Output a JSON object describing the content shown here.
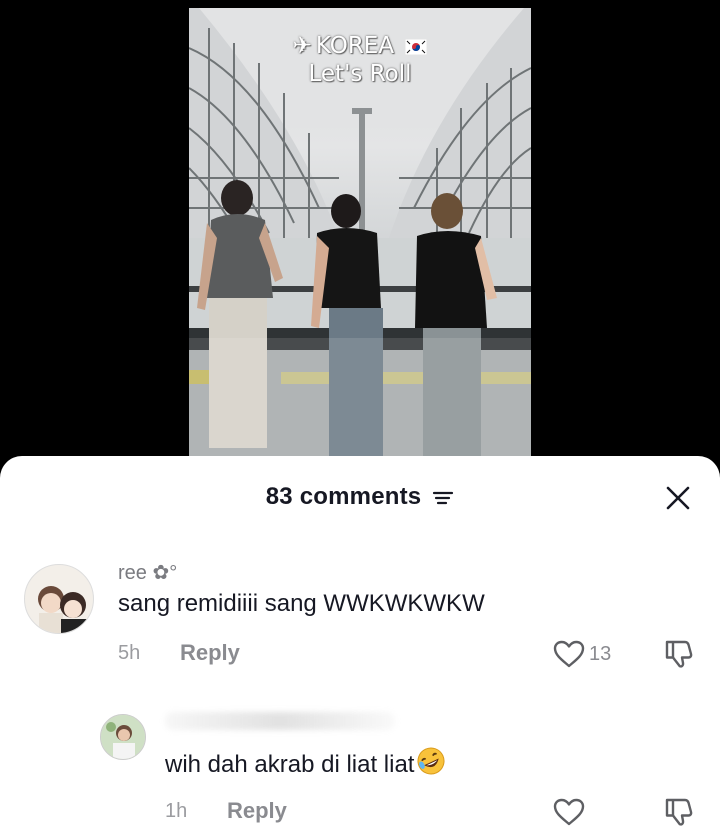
{
  "video": {
    "caption_line1": "KOREA",
    "caption_line2": "Let's Roll",
    "caption_icons": [
      "airplane-icon",
      "korea-flag-icon"
    ]
  },
  "comments_panel": {
    "title": "83 comments",
    "sort_icon": "sort-lines-icon",
    "close_icon": "close-icon",
    "comments": [
      {
        "username": "ree ✿°",
        "text": "sang remidiiii sang WWKWKWKW",
        "time": "5h",
        "reply_label": "Reply",
        "likes": "13"
      },
      {
        "username": "",
        "text": "wih dah akrab di liat liat",
        "emoji": "rolling-on-floor-laughing-emoji",
        "time": "1h",
        "reply_label": "Reply",
        "likes": ""
      }
    ]
  },
  "colors": {
    "text_primary": "#161823",
    "text_secondary": "#8a8b90",
    "sheet_bg": "#ffffff",
    "background": "#000000"
  }
}
